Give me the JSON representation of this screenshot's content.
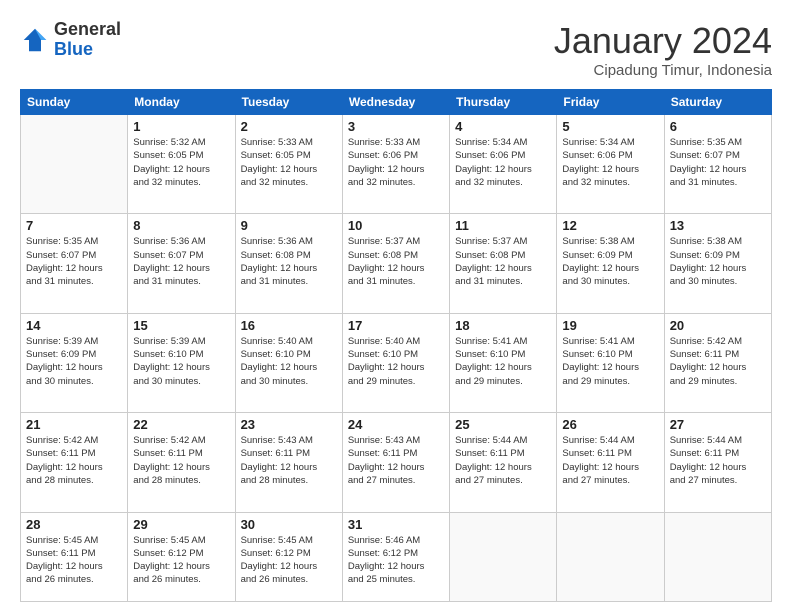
{
  "logo": {
    "general": "General",
    "blue": "Blue"
  },
  "title": "January 2024",
  "subtitle": "Cipadung Timur, Indonesia",
  "days_header": [
    "Sunday",
    "Monday",
    "Tuesday",
    "Wednesday",
    "Thursday",
    "Friday",
    "Saturday"
  ],
  "weeks": [
    [
      {
        "num": "",
        "info": ""
      },
      {
        "num": "1",
        "info": "Sunrise: 5:32 AM\nSunset: 6:05 PM\nDaylight: 12 hours\nand 32 minutes."
      },
      {
        "num": "2",
        "info": "Sunrise: 5:33 AM\nSunset: 6:05 PM\nDaylight: 12 hours\nand 32 minutes."
      },
      {
        "num": "3",
        "info": "Sunrise: 5:33 AM\nSunset: 6:06 PM\nDaylight: 12 hours\nand 32 minutes."
      },
      {
        "num": "4",
        "info": "Sunrise: 5:34 AM\nSunset: 6:06 PM\nDaylight: 12 hours\nand 32 minutes."
      },
      {
        "num": "5",
        "info": "Sunrise: 5:34 AM\nSunset: 6:06 PM\nDaylight: 12 hours\nand 32 minutes."
      },
      {
        "num": "6",
        "info": "Sunrise: 5:35 AM\nSunset: 6:07 PM\nDaylight: 12 hours\nand 31 minutes."
      }
    ],
    [
      {
        "num": "7",
        "info": "Sunrise: 5:35 AM\nSunset: 6:07 PM\nDaylight: 12 hours\nand 31 minutes."
      },
      {
        "num": "8",
        "info": "Sunrise: 5:36 AM\nSunset: 6:07 PM\nDaylight: 12 hours\nand 31 minutes."
      },
      {
        "num": "9",
        "info": "Sunrise: 5:36 AM\nSunset: 6:08 PM\nDaylight: 12 hours\nand 31 minutes."
      },
      {
        "num": "10",
        "info": "Sunrise: 5:37 AM\nSunset: 6:08 PM\nDaylight: 12 hours\nand 31 minutes."
      },
      {
        "num": "11",
        "info": "Sunrise: 5:37 AM\nSunset: 6:08 PM\nDaylight: 12 hours\nand 31 minutes."
      },
      {
        "num": "12",
        "info": "Sunrise: 5:38 AM\nSunset: 6:09 PM\nDaylight: 12 hours\nand 30 minutes."
      },
      {
        "num": "13",
        "info": "Sunrise: 5:38 AM\nSunset: 6:09 PM\nDaylight: 12 hours\nand 30 minutes."
      }
    ],
    [
      {
        "num": "14",
        "info": "Sunrise: 5:39 AM\nSunset: 6:09 PM\nDaylight: 12 hours\nand 30 minutes."
      },
      {
        "num": "15",
        "info": "Sunrise: 5:39 AM\nSunset: 6:10 PM\nDaylight: 12 hours\nand 30 minutes."
      },
      {
        "num": "16",
        "info": "Sunrise: 5:40 AM\nSunset: 6:10 PM\nDaylight: 12 hours\nand 30 minutes."
      },
      {
        "num": "17",
        "info": "Sunrise: 5:40 AM\nSunset: 6:10 PM\nDaylight: 12 hours\nand 29 minutes."
      },
      {
        "num": "18",
        "info": "Sunrise: 5:41 AM\nSunset: 6:10 PM\nDaylight: 12 hours\nand 29 minutes."
      },
      {
        "num": "19",
        "info": "Sunrise: 5:41 AM\nSunset: 6:10 PM\nDaylight: 12 hours\nand 29 minutes."
      },
      {
        "num": "20",
        "info": "Sunrise: 5:42 AM\nSunset: 6:11 PM\nDaylight: 12 hours\nand 29 minutes."
      }
    ],
    [
      {
        "num": "21",
        "info": "Sunrise: 5:42 AM\nSunset: 6:11 PM\nDaylight: 12 hours\nand 28 minutes."
      },
      {
        "num": "22",
        "info": "Sunrise: 5:42 AM\nSunset: 6:11 PM\nDaylight: 12 hours\nand 28 minutes."
      },
      {
        "num": "23",
        "info": "Sunrise: 5:43 AM\nSunset: 6:11 PM\nDaylight: 12 hours\nand 28 minutes."
      },
      {
        "num": "24",
        "info": "Sunrise: 5:43 AM\nSunset: 6:11 PM\nDaylight: 12 hours\nand 27 minutes."
      },
      {
        "num": "25",
        "info": "Sunrise: 5:44 AM\nSunset: 6:11 PM\nDaylight: 12 hours\nand 27 minutes."
      },
      {
        "num": "26",
        "info": "Sunrise: 5:44 AM\nSunset: 6:11 PM\nDaylight: 12 hours\nand 27 minutes."
      },
      {
        "num": "27",
        "info": "Sunrise: 5:44 AM\nSunset: 6:11 PM\nDaylight: 12 hours\nand 27 minutes."
      }
    ],
    [
      {
        "num": "28",
        "info": "Sunrise: 5:45 AM\nSunset: 6:11 PM\nDaylight: 12 hours\nand 26 minutes."
      },
      {
        "num": "29",
        "info": "Sunrise: 5:45 AM\nSunset: 6:12 PM\nDaylight: 12 hours\nand 26 minutes."
      },
      {
        "num": "30",
        "info": "Sunrise: 5:45 AM\nSunset: 6:12 PM\nDaylight: 12 hours\nand 26 minutes."
      },
      {
        "num": "31",
        "info": "Sunrise: 5:46 AM\nSunset: 6:12 PM\nDaylight: 12 hours\nand 25 minutes."
      },
      {
        "num": "",
        "info": ""
      },
      {
        "num": "",
        "info": ""
      },
      {
        "num": "",
        "info": ""
      }
    ]
  ]
}
